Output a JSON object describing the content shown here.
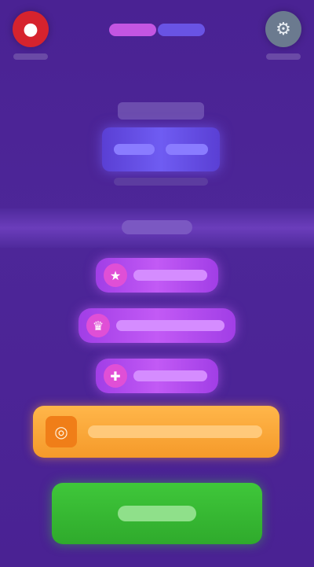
{
  "colors": {
    "background": "#4b2394",
    "accent_red": "#d6232e",
    "accent_gray": "#6b7a8f",
    "menu_purple": "#c25af5",
    "banner_orange": "#f59a2a",
    "play_green": "#3fc73a"
  },
  "top_bar": {
    "left_button": {
      "icon": "record-icon"
    },
    "right_button": {
      "icon": "settings-icon"
    },
    "logo": {
      "icon": "game-logo"
    }
  },
  "emblem": {
    "icon": "emblem-icon"
  },
  "menu": [
    {
      "icon": "star-icon"
    },
    {
      "icon": "trophy-icon"
    },
    {
      "icon": "gift-icon"
    }
  ],
  "orange_banner": {
    "icon": "coin-icon"
  },
  "play_button": {
    "icon": "play-icon"
  }
}
